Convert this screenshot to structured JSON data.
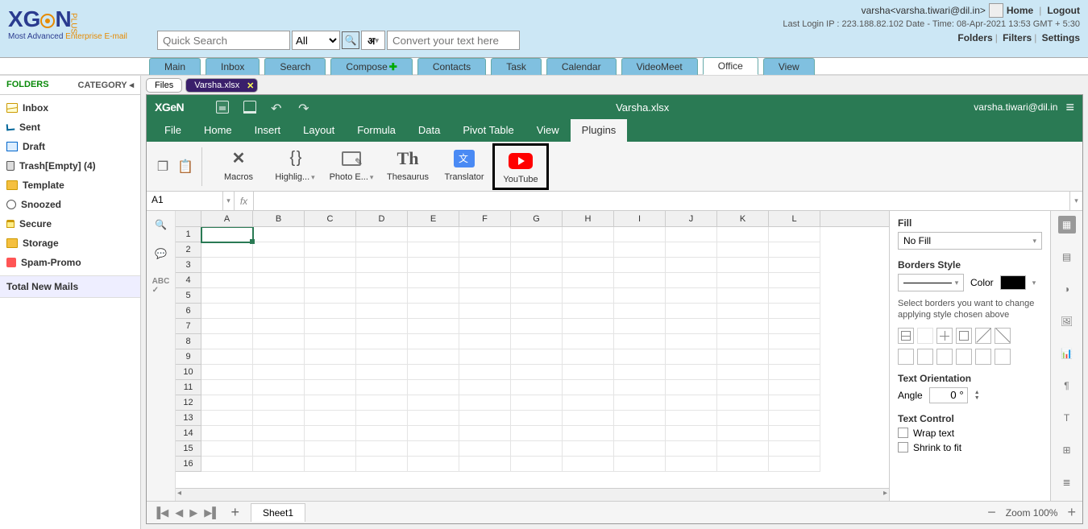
{
  "header": {
    "logo_main": "XGeN",
    "logo_plus": "PLUS",
    "logo_tagline_1": "Most Advanced ",
    "logo_tagline_2": "Enterprise E-mail",
    "search_placeholder": "Quick Search",
    "search_filter": "All",
    "lang_glyph": "अ",
    "convert_placeholder": "Convert your text here",
    "user_display": "varsha<varsha.tiwari@dil.in>",
    "home_link": "Home",
    "logout_link": "Logout",
    "last_login": "Last Login IP : 223.188.82.102 Date - Time: 08-Apr-2021 13:53 GMT + 5:30",
    "link_folders": "Folders",
    "link_filters": "Filters",
    "link_settings": "Settings"
  },
  "main_tabs": [
    "Main",
    "Inbox",
    "Search",
    "Compose",
    "Contacts",
    "Task",
    "Calendar",
    "VideoMeet",
    "Office",
    "View"
  ],
  "active_main_tab": "Office",
  "sidebar": {
    "header_folders": "FOLDERS",
    "header_category": "CATEGORY",
    "items": [
      {
        "label": "Inbox",
        "bold": true,
        "icon": "inbox"
      },
      {
        "label": "Sent",
        "bold": true,
        "icon": "sent"
      },
      {
        "label": "Draft",
        "bold": true,
        "icon": "draft"
      },
      {
        "label": "Trash[Empty] (4)",
        "bold": true,
        "icon": "trash"
      },
      {
        "label": "Template",
        "bold": true,
        "icon": "folder"
      },
      {
        "label": "Snoozed",
        "bold": true,
        "icon": "clock"
      },
      {
        "label": "Secure",
        "bold": true,
        "icon": "lock"
      },
      {
        "label": "Storage",
        "bold": true,
        "icon": "folder"
      },
      {
        "label": "Spam-Promo",
        "bold": true,
        "icon": "spam"
      }
    ],
    "total_new": "Total New Mails"
  },
  "file_tabs": {
    "files": "Files",
    "active": "Varsha.xlsx"
  },
  "sheet": {
    "brand": "XGeN",
    "filename": "Varsha.xlsx",
    "user_email": "varsha.tiwari@dil.in",
    "menus": [
      "File",
      "Home",
      "Insert",
      "Layout",
      "Formula",
      "Data",
      "Pivot Table",
      "View",
      "Plugins"
    ],
    "active_menu": "Plugins",
    "plugins": [
      {
        "label": "Macros",
        "icon": "macros"
      },
      {
        "label": "Highlig...",
        "icon": "highlight",
        "dd": true
      },
      {
        "label": "Photo E...",
        "icon": "photo",
        "dd": true
      },
      {
        "label": "Thesaurus",
        "icon": "thesaurus"
      },
      {
        "label": "Translator",
        "icon": "translate"
      },
      {
        "label": "YouTube",
        "icon": "youtube",
        "highlighted": true
      }
    ],
    "cell_ref": "A1",
    "fx": "fx",
    "columns": [
      "A",
      "B",
      "C",
      "D",
      "E",
      "F",
      "G",
      "H",
      "I",
      "J",
      "K",
      "L"
    ],
    "rows": 16,
    "selected": {
      "row": 1,
      "col": "A"
    },
    "right_panel": {
      "fill_label": "Fill",
      "fill_value": "No Fill",
      "borders_label": "Borders Style",
      "color_label": "Color",
      "hint": "Select borders you want to change applying style chosen above",
      "orientation_label": "Text Orientation",
      "angle_label": "Angle",
      "angle_value": "0 °",
      "control_label": "Text Control",
      "wrap_label": "Wrap text",
      "shrink_label": "Shrink to fit"
    },
    "footer": {
      "sheet_name": "Sheet1",
      "zoom": "Zoom 100%"
    }
  }
}
